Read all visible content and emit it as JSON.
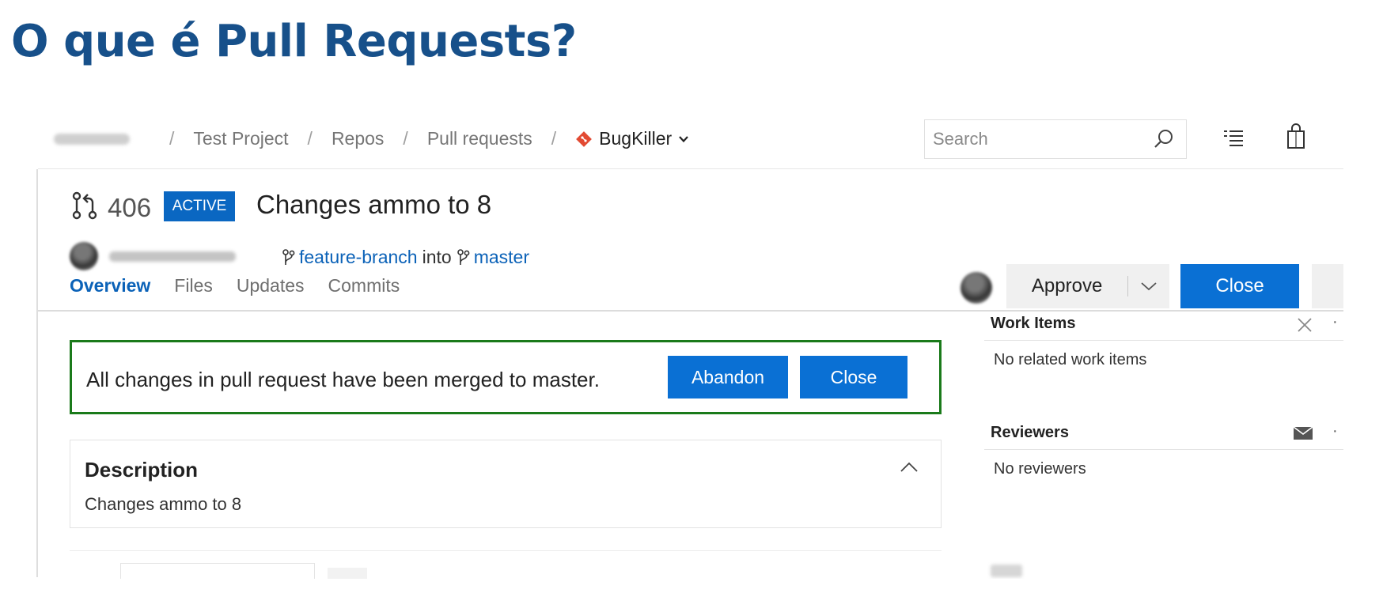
{
  "slide": {
    "title": "O que é Pull Requests?"
  },
  "header": {
    "breadcrumb": {
      "project": "Test Project",
      "repos": "Repos",
      "pull_requests": "Pull requests",
      "repo": "BugKiller",
      "separator": "/"
    },
    "search": {
      "placeholder": "Search"
    },
    "icons": [
      "search-icon",
      "work-list-icon",
      "shopping-bag-icon"
    ]
  },
  "pull_request": {
    "number": "406",
    "status": "ACTIVE",
    "title": "Changes ammo to 8",
    "source_branch": "feature-branch",
    "into_text": "into",
    "target_branch": "master",
    "actions": {
      "approve": "Approve",
      "close": "Close"
    },
    "tabs": [
      {
        "label": "Overview",
        "active": true
      },
      {
        "label": "Files",
        "active": false
      },
      {
        "label": "Updates",
        "active": false
      },
      {
        "label": "Commits",
        "active": false
      }
    ]
  },
  "merge_banner": {
    "message": "All changes in pull request have been merged to master.",
    "abandon": "Abandon",
    "close": "Close"
  },
  "description": {
    "title": "Description",
    "text": "Changes ammo to 8"
  },
  "side_panel": {
    "work_items": {
      "title": "Work Items",
      "empty": "No related work items"
    },
    "reviewers": {
      "title": "Reviewers",
      "empty": "No reviewers"
    }
  },
  "colors": {
    "title_blue": "#17508a",
    "primary_button": "#0a70d4",
    "link_blue": "#0b62b8",
    "merged_border": "#1a7a1a",
    "repo_icon": "#e24a32"
  }
}
